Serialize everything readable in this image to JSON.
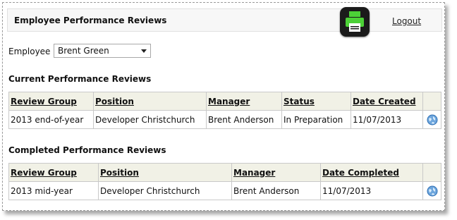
{
  "header": {
    "title": "Employee Performance Reviews",
    "logout_label": "Logout"
  },
  "employee": {
    "label": "Employee",
    "selected": "Brent Green"
  },
  "current_reviews": {
    "title": "Current Performance Reviews",
    "columns": [
      "Review Group",
      "Position",
      "Manager",
      "Status",
      "Date Created"
    ],
    "rows": [
      [
        "2013 end-of-year",
        "Developer Christchurch",
        "Brent Anderson",
        "In Preparation",
        "11/07/2013"
      ]
    ]
  },
  "completed_reviews": {
    "title": "Completed Performance Reviews",
    "columns": [
      "Review Group",
      "Position",
      "Manager",
      "Date Completed"
    ],
    "rows": [
      [
        "2013 mid-year",
        "Developer Christchurch",
        "Brent Anderson",
        "11/07/2013"
      ]
    ]
  },
  "icons": {
    "print": "printer-icon",
    "view": "globe-view-icon"
  },
  "colors": {
    "header_row_bg": "#f1f1e6",
    "print_button_bg": "#1b1b1b",
    "print_icon_accent": "#4cd137"
  }
}
